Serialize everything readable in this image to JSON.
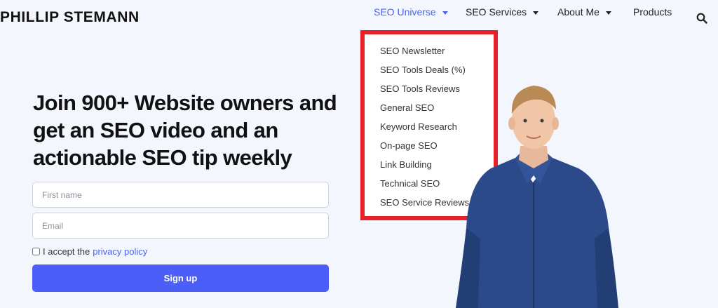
{
  "header": {
    "logo": "PHILLIP STEMANN",
    "nav": [
      {
        "label": "SEO Universe",
        "active": true,
        "has_caret": true
      },
      {
        "label": "SEO Services",
        "active": false,
        "has_caret": true
      },
      {
        "label": "About Me",
        "active": false,
        "has_caret": true
      },
      {
        "label": "Products",
        "active": false,
        "has_caret": false
      }
    ],
    "search_icon": "search-icon"
  },
  "dropdown": {
    "items": [
      "SEO Newsletter",
      "SEO Tools Deals (%)",
      "SEO Tools Reviews",
      "General SEO",
      "Keyword Research",
      "On-page SEO",
      "Link Building",
      "Technical SEO",
      "SEO Service Reviews"
    ]
  },
  "hero": {
    "headline": "Join 900+ Website owners and get an SEO video and an actionable SEO tip weekly",
    "first_name_placeholder": "First name",
    "email_placeholder": "Email",
    "consent_text": "I accept the",
    "privacy_link": "privacy policy",
    "signup_label": "Sign up"
  },
  "colors": {
    "accent": "#4a63f0",
    "button": "#4b5ef7",
    "highlight_border": "#e8202a",
    "background": "#f4f6fd"
  }
}
